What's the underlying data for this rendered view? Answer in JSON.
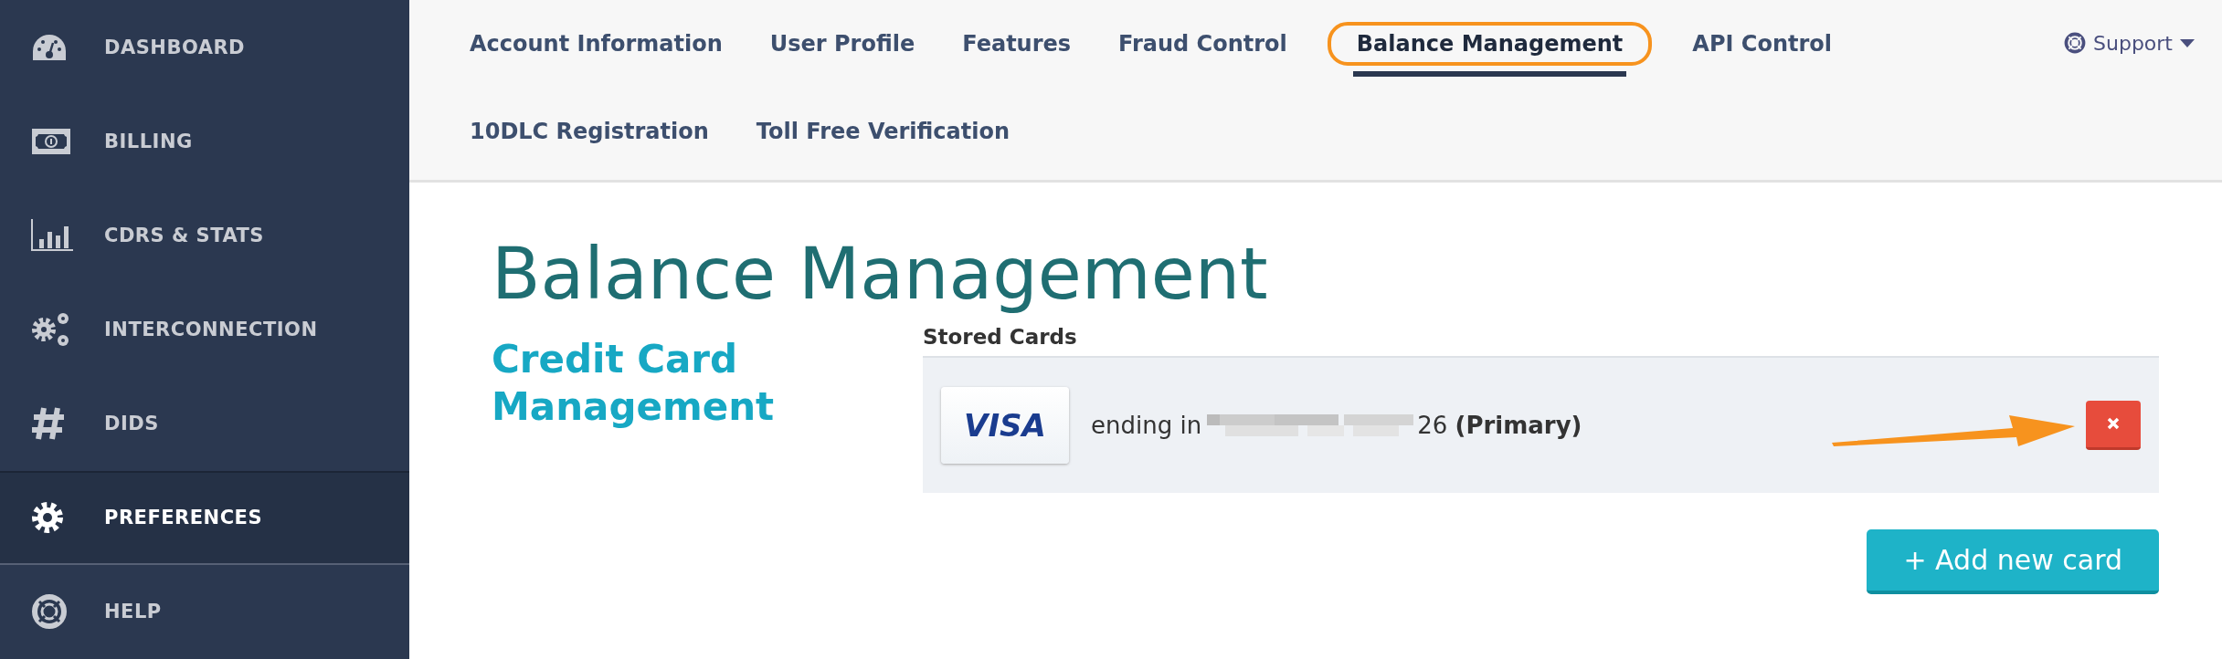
{
  "sidebar": {
    "items": [
      {
        "label": "DASHBOARD",
        "kind": "dashboard",
        "selected": false
      },
      {
        "label": "BILLING",
        "kind": "billing",
        "selected": false
      },
      {
        "label": "CDRS & STATS",
        "kind": "stats",
        "selected": false
      },
      {
        "label": "INTERCONNECTION",
        "kind": "interconnection",
        "selected": false
      },
      {
        "label": "DIDS",
        "kind": "dids",
        "selected": false
      },
      {
        "label": "PREFERENCES",
        "kind": "preferences",
        "selected": true
      },
      {
        "label": "HELP",
        "kind": "help",
        "selected": false
      }
    ]
  },
  "tabs": [
    [
      {
        "label": "Account Information",
        "selected": false
      },
      {
        "label": "User Profile",
        "selected": false
      },
      {
        "label": "Features",
        "selected": false
      },
      {
        "label": "Fraud Control",
        "selected": false
      },
      {
        "label": "Balance Management",
        "selected": true
      },
      {
        "label": "API Control",
        "selected": false
      }
    ],
    [
      {
        "label": "10DLC Registration",
        "selected": false
      },
      {
        "label": "Toll Free Verification",
        "selected": false
      }
    ]
  ],
  "support_menu": {
    "label": "Support"
  },
  "page": {
    "title": "Balance Management",
    "section_title": "Credit Card Management",
    "stored_cards": {
      "heading": "Stored Cards",
      "cards": [
        {
          "brand": "VISA",
          "prefix": "ending in",
          "suffix": "26 **(Primary)**"
        }
      ]
    },
    "add_button": "+ Add new card"
  }
}
